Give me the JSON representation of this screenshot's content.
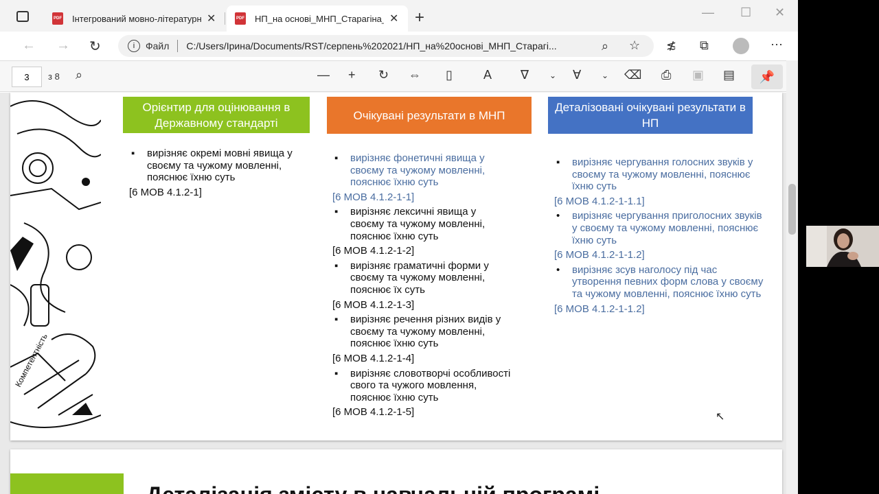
{
  "tabs": [
    {
      "title": "Інтегрований мовно-літературн…",
      "icon": "pdf-icon"
    },
    {
      "title": "НП_на основі_МНП_Старагіна_…",
      "icon": "pdf-icon"
    }
  ],
  "address": {
    "label": "Файл",
    "url": "C:/Users/Ірина/Documents/RST/серпень%202021/НП_на%20основі_МНП_Старагі..."
  },
  "pdf_toolbar": {
    "page": "3",
    "total": "з 8"
  },
  "columns": [
    {
      "header": "Орієнтир для оцінювання в Державному стандарті",
      "color": "#8dc21f",
      "items": [
        {
          "text": "вирізняє окремі мовні явища у своєму та чужому мовленні, пояснює їхню суть",
          "code": "[6 МОВ 4.1.2-1]"
        }
      ]
    },
    {
      "header": "Очікувані результати в МНП",
      "color": "#e9762b",
      "items": [
        {
          "text": "вирізняє фонетичні явища у своєму та чужому мовленні, пояснює їхню суть",
          "code": "[6 МОВ 4.1.2-1-1]"
        },
        {
          "text": "вирізняє лексичні явища у своєму та чужому мовленні, пояснює їхню суть",
          "code": "[6 МОВ 4.1.2-1-2]"
        },
        {
          "text": "вирізняє граматичні форми у своєму та чужому мовленні, пояснює їх суть",
          "code": "[6 МОВ 4.1.2-1-3]"
        },
        {
          "text": "вирізняє речення різних видів у своєму та чужому мовленні, пояснює їхню суть",
          "code": "[6 МОВ 4.1.2-1-4]"
        },
        {
          "text": "вирізняє словотворчі особливості свого та чужого мовлення, пояснює їхню суть",
          "code": "[6 МОВ 4.1.2-1-5]"
        }
      ]
    },
    {
      "header": "Деталізовані очікувані результати в НП",
      "color": "#4472c4",
      "items": [
        {
          "text": "вирізняє чергування голосних звуків у своєму та чужому мовленні, пояснює їхню суть",
          "code": "[6 МОВ 4.1.2-1-1.1]"
        },
        {
          "text": "вирізняє чергування приголосних звуків у своєму та чужому мовленні, пояснює їхню суть",
          "code": "[6 МОВ 4.1.2-1-1.2]"
        },
        {
          "text": "вирізняє зсув наголосу під час утворення певних форм слова  у своєму та чужому мовленні, пояснює їхню суть",
          "code": "[6 МОВ 4.1.2-1-1.2]"
        }
      ]
    }
  ],
  "doodle_text": "Компетентність",
  "page2_title": "Деталізація змісту в навчальній програмі"
}
